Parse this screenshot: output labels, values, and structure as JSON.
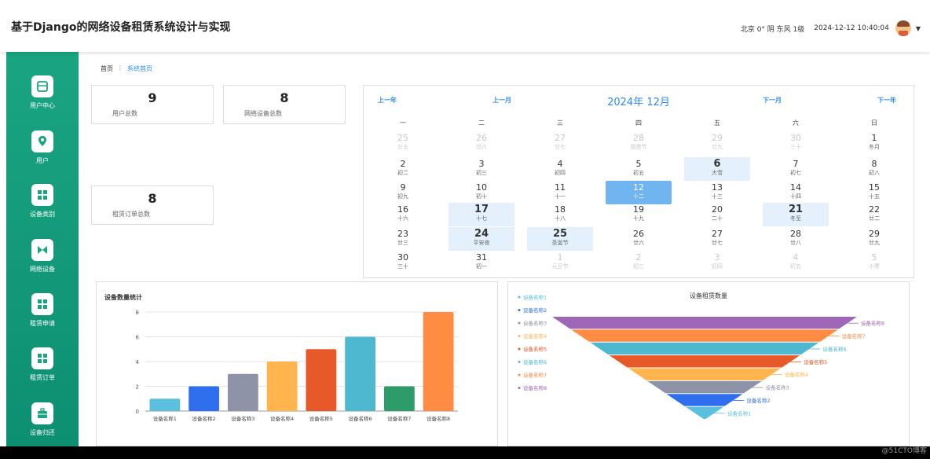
{
  "app": {
    "title": "基于Django的网络设备租赁系统设计与实现"
  },
  "header": {
    "weather": "北京  0°  阴  东风  1级",
    "datetime": "2024-12-12 10:40:04"
  },
  "sidebar": {
    "items": [
      {
        "label": "用户中心",
        "icon": "user-center-icon"
      },
      {
        "label": "用户",
        "icon": "user-icon"
      },
      {
        "label": "设备类别",
        "icon": "category-icon"
      },
      {
        "label": "网络设备",
        "icon": "network-device-icon"
      },
      {
        "label": "租赁申请",
        "icon": "apply-icon"
      },
      {
        "label": "租赁订单",
        "icon": "order-icon"
      },
      {
        "label": "设备归还",
        "icon": "return-icon"
      }
    ]
  },
  "breadcrumb": {
    "home": "首页",
    "current": "系统首页"
  },
  "stats": [
    {
      "value": "9",
      "label": "用户总数"
    },
    {
      "value": "8",
      "label": "网络设备总数"
    },
    {
      "value": "8",
      "label": "租赁订单总数"
    }
  ],
  "calendar": {
    "prev_year": "上一年",
    "prev_month": "上一月",
    "title": "2024年 12月",
    "next_month": "下一月",
    "next_year": "下一年",
    "weekdays": [
      "一",
      "二",
      "三",
      "四",
      "五",
      "六",
      "日"
    ],
    "weeks": [
      [
        {
          "n": "25",
          "l": "廿五",
          "o": 1
        },
        {
          "n": "26",
          "l": "廿六",
          "o": 1
        },
        {
          "n": "27",
          "l": "廿七",
          "o": 1
        },
        {
          "n": "28",
          "l": "感恩节",
          "o": 1
        },
        {
          "n": "29",
          "l": "廿九",
          "o": 1
        },
        {
          "n": "30",
          "l": "三十",
          "o": 1
        },
        {
          "n": "1",
          "l": "冬月"
        }
      ],
      [
        {
          "n": "2",
          "l": "初二"
        },
        {
          "n": "3",
          "l": "初三"
        },
        {
          "n": "4",
          "l": "初四"
        },
        {
          "n": "5",
          "l": "初五"
        },
        {
          "n": "6",
          "l": "大雪",
          "h": 1
        },
        {
          "n": "7",
          "l": "初七"
        },
        {
          "n": "8",
          "l": "初八"
        }
      ],
      [
        {
          "n": "9",
          "l": "初九"
        },
        {
          "n": "10",
          "l": "初十"
        },
        {
          "n": "11",
          "l": "十一"
        },
        {
          "n": "12",
          "l": "十二",
          "t": 1
        },
        {
          "n": "13",
          "l": "十三"
        },
        {
          "n": "14",
          "l": "十四"
        },
        {
          "n": "15",
          "l": "十五"
        }
      ],
      [
        {
          "n": "16",
          "l": "十六"
        },
        {
          "n": "17",
          "l": "十七",
          "h": 1
        },
        {
          "n": "18",
          "l": "十八"
        },
        {
          "n": "19",
          "l": "十九"
        },
        {
          "n": "20",
          "l": "二十"
        },
        {
          "n": "21",
          "l": "冬至",
          "h": 1
        },
        {
          "n": "22",
          "l": "廿二"
        }
      ],
      [
        {
          "n": "23",
          "l": "廿三"
        },
        {
          "n": "24",
          "l": "平安夜",
          "h": 1
        },
        {
          "n": "25",
          "l": "圣诞节",
          "h": 1
        },
        {
          "n": "26",
          "l": "廿六"
        },
        {
          "n": "27",
          "l": "廿七"
        },
        {
          "n": "28",
          "l": "廿八"
        },
        {
          "n": "29",
          "l": "廿九"
        }
      ],
      [
        {
          "n": "30",
          "l": "三十"
        },
        {
          "n": "31",
          "l": "初一"
        },
        {
          "n": "1",
          "l": "元旦节",
          "o": 1
        },
        {
          "n": "2",
          "l": "初三",
          "o": 1
        },
        {
          "n": "3",
          "l": "初四",
          "o": 1
        },
        {
          "n": "4",
          "l": "初五",
          "o": 1
        },
        {
          "n": "5",
          "l": "小寒",
          "o": 1
        }
      ]
    ]
  },
  "chart_data": [
    {
      "type": "bar",
      "title": "设备数量统计",
      "categories": [
        "设备名称1",
        "设备名称2",
        "设备名称3",
        "设备名称4",
        "设备名称5",
        "设备名称6",
        "设备名称7",
        "设备名称8"
      ],
      "values": [
        1,
        2,
        3,
        4,
        5,
        6,
        2,
        8
      ],
      "colors": [
        "#5bc0de",
        "#2f6fed",
        "#8e93a8",
        "#ffb44d",
        "#e8592a",
        "#4eb8d0",
        "#2e9b6a",
        "#ff8c42"
      ],
      "ylim": [
        0,
        8
      ],
      "yticks": [
        0,
        2,
        4,
        6,
        8
      ],
      "grid": true
    },
    {
      "type": "funnel",
      "title": "设备租赁数量",
      "categories": [
        "设备名称8",
        "设备名称7",
        "设备名称6",
        "设备名称5",
        "设备名称4",
        "设备名称3",
        "设备名称2",
        "设备名称1"
      ],
      "colors": [
        "#9e67b7",
        "#ff8c42",
        "#4eb8d0",
        "#e8592a",
        "#ffb44d",
        "#8e93a8",
        "#2f6fed",
        "#5bc0de"
      ],
      "legend": [
        "设备名称1",
        "设备名称2",
        "设备名称3",
        "设备名称4",
        "设备名称5",
        "设备名称6",
        "设备名称7",
        "设备名称8"
      ],
      "legend_colors": [
        "#5bc0de",
        "#2f6fed",
        "#8e93a8",
        "#ffb44d",
        "#e8592a",
        "#4eb8d0",
        "#ff8c42",
        "#9e67b7"
      ],
      "legend_position": "left"
    }
  ],
  "watermark": "@51CTO博客"
}
